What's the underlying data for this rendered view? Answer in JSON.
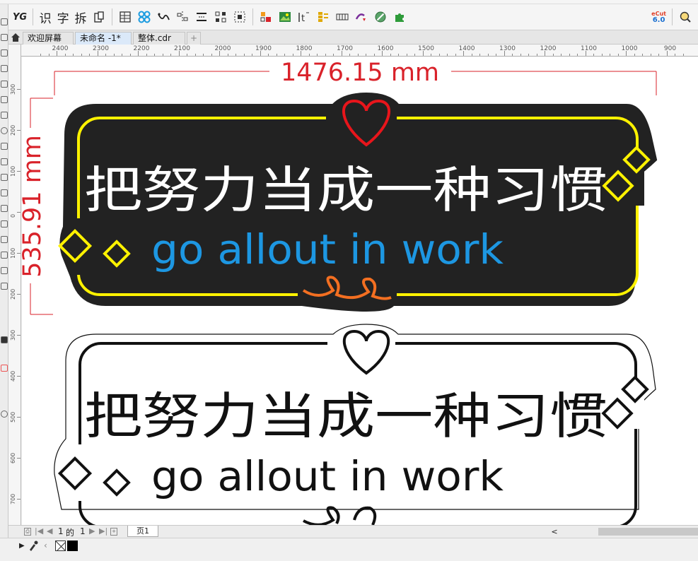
{
  "toolbar": {
    "text_tools": [
      "识",
      "字",
      "拆"
    ],
    "yg_label": "YG",
    "ecut_label_top": "eCut",
    "ecut_label_bottom": "6.0",
    "icons": [
      "plugin-yg-icon",
      "recognize-icon",
      "font-icon",
      "split-icon",
      "clipboard-icon",
      "table-icon",
      "pattern-icon",
      "curve-icon",
      "align-icon",
      "spacing-icon",
      "grid-icon",
      "select-icon",
      "color-replace-icon",
      "image-icon",
      "text-tool-icon",
      "barcode-icon",
      "film-icon",
      "node-icon",
      "gradient-icon",
      "puzzle-icon",
      "ecut-icon",
      "search-icon"
    ]
  },
  "tabs": [
    {
      "label": "欢迎屏幕",
      "active": false
    },
    {
      "label": "未命名 -1*",
      "active": true
    },
    {
      "label": "整体.cdr",
      "active": false
    },
    {
      "label": "+",
      "active": false
    }
  ],
  "ruler": {
    "h_ticks": [
      "2400",
      "2300",
      "2200",
      "2100",
      "2000",
      "1900",
      "1800",
      "1700",
      "1600",
      "1500",
      "1400",
      "1300",
      "1200",
      "1100",
      "1000",
      "900"
    ],
    "v_ticks": [
      "300",
      "200",
      "100",
      "0",
      "100",
      "200",
      "300",
      "400",
      "500",
      "600",
      "700"
    ]
  },
  "canvas": {
    "width_dim": "1476.15 mm",
    "height_dim": "535.91 mm",
    "sign_text": "把努力当成一种习惯",
    "sign_subtext": "go allout in work",
    "colors": {
      "dim": "#d9222a",
      "board": "#222222",
      "border": "#fff200",
      "heart": "#e8151b",
      "sub": "#1d97e2",
      "swirl": "#f36f21",
      "diamond": "#fff200"
    }
  },
  "status": {
    "page_current": "1",
    "page_of": "的",
    "page_total": "1",
    "page_tab": "页1",
    "scroll_arrow": "<"
  }
}
